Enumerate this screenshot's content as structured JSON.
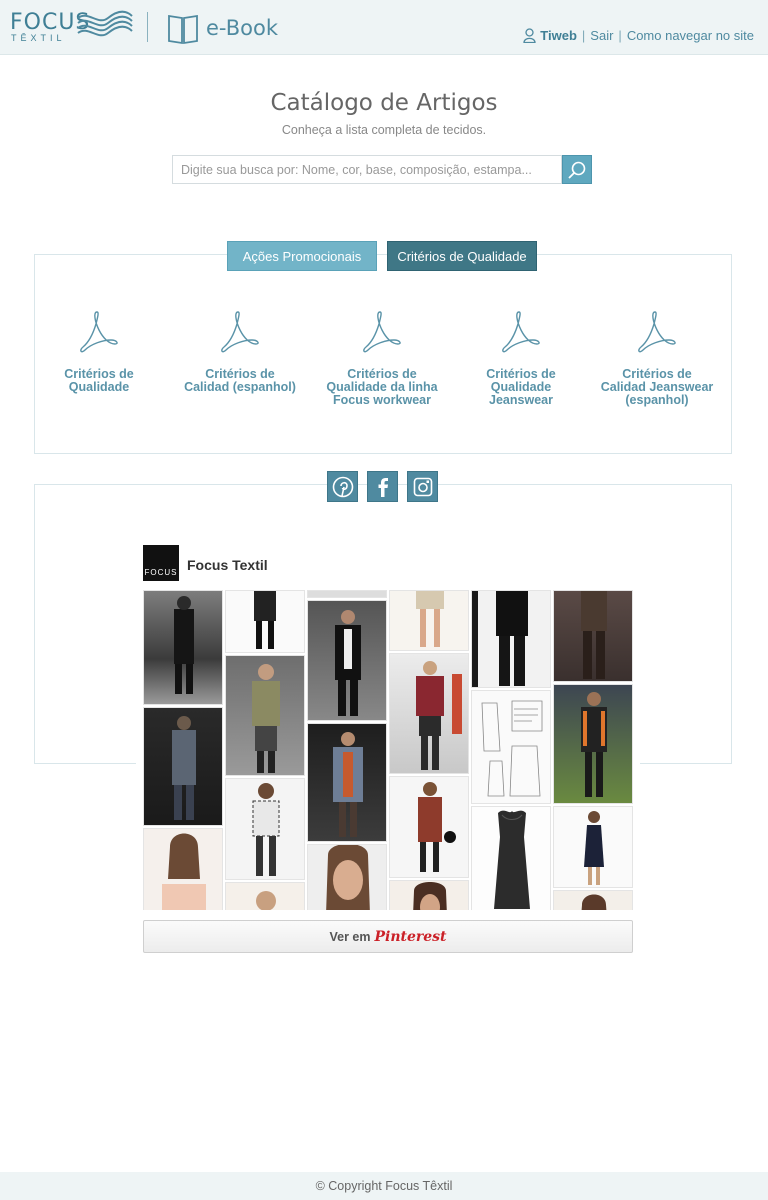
{
  "header": {
    "logo_text": "FOCUS",
    "logo_sub": "TÊXTIL",
    "ebook_label": "e-Book",
    "user_name": "Tiweb",
    "logout_label": "Sair",
    "nav_help_label": "Como navegar no site"
  },
  "catalog": {
    "title": "Catálogo de Artigos",
    "subtitle": "Conheça a lista completa de tecidos.",
    "search_placeholder": "Digite sua busca por: Nome, cor, base, composição, estampa..."
  },
  "tabs": {
    "promo": "Ações Promocionais",
    "quality": "Critérios de Qualidade"
  },
  "documents": [
    {
      "line1": "Critérios de",
      "line2": "Qualidade",
      "line3": ""
    },
    {
      "line1": "Critérios de",
      "line2": "Calidad (espanhol)",
      "line3": ""
    },
    {
      "line1": "Critérios de",
      "line2": "Qualidade da linha",
      "line3": "Focus workwear"
    },
    {
      "line1": "Critérios de",
      "line2": "Qualidade",
      "line3": "Jeanswear"
    },
    {
      "line1": "Critérios de",
      "line2": "Calidad Jeanswear",
      "line3": "(espanhol)"
    }
  ],
  "social": {
    "icons": [
      "pinterest-icon",
      "facebook-icon",
      "instagram-icon"
    ]
  },
  "pinterest": {
    "profile_name": "Focus Textil",
    "avatar_text": "FOCUS",
    "button_prefix": "Ver em",
    "button_brand": "Pinterest"
  },
  "footer": {
    "copyright": "© Copyright Focus Têxtil"
  },
  "colors": {
    "accent": "#4f8aa0",
    "tab_active": "#3f7786",
    "tab_inactive": "#72b4c8",
    "header_bg": "#eef4f5"
  }
}
